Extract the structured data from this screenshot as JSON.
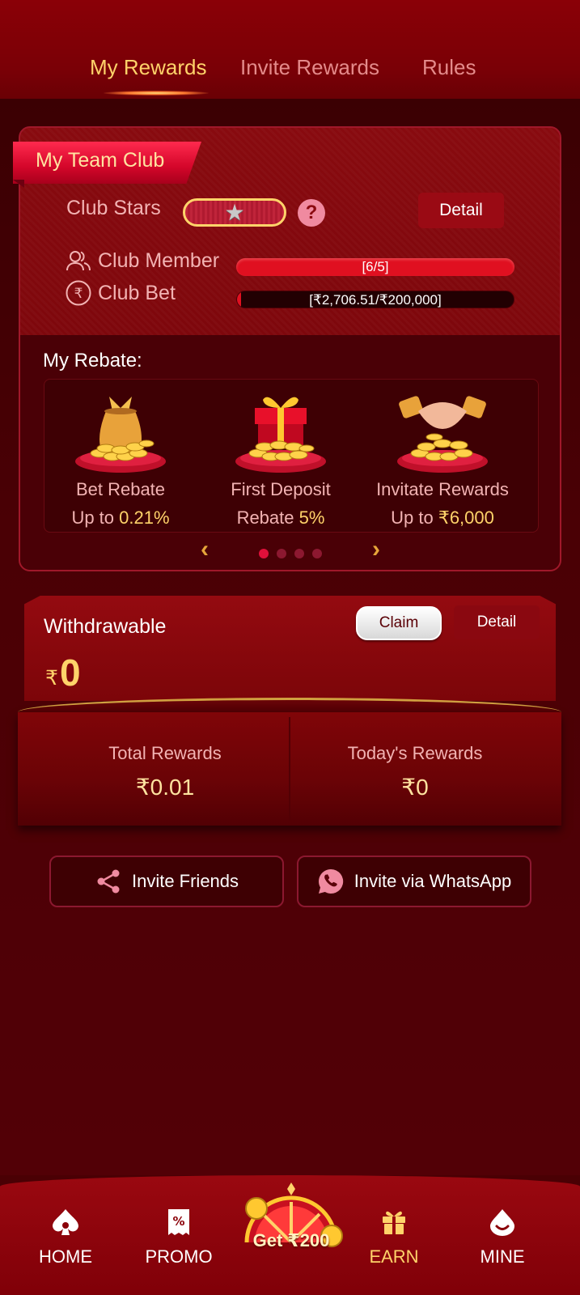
{
  "tabs": [
    {
      "label": "My Rewards",
      "active": true
    },
    {
      "label": "Invite Rewards",
      "active": false
    },
    {
      "label": "Rules",
      "active": false
    }
  ],
  "club": {
    "title": "My Team Club",
    "stars_label": "Club Stars",
    "stars_filled": 1,
    "detail_label": "Detail",
    "member_label": "Club Member",
    "member_progress": "[6/5]",
    "member_fraction": 1.0,
    "bet_label": "Club Bet",
    "bet_progress": "[₹2,706.51/₹200,000]",
    "bet_fraction": 0.0135
  },
  "rebate": {
    "title": "My Rebate:",
    "items": [
      {
        "name": "Bet Rebate",
        "prefix": "Up to",
        "value": "0.21%",
        "icon": "money-bag-icon"
      },
      {
        "name": "First Deposit",
        "prefix": "Rebate",
        "value": "5%",
        "icon": "gift-box-icon"
      },
      {
        "name": "Invitate Rewards",
        "prefix": "Up to",
        "value": "₹6,000",
        "icon": "handshake-icon"
      }
    ],
    "page_count": 4,
    "page_active": 1
  },
  "withdraw": {
    "title": "Withdrawable",
    "currency": "₹",
    "amount": "0",
    "claim_label": "Claim",
    "detail_label": "Detail"
  },
  "totals": {
    "total_label": "Total Rewards",
    "total_value": "₹0.01",
    "today_label": "Today's Rewards",
    "today_value": "₹0"
  },
  "invite": {
    "friends_label": "Invite Friends",
    "whatsapp_label": "Invite via WhatsApp"
  },
  "nav": {
    "home": "HOME",
    "promo": "PROMO",
    "wheel": "Get ₹200",
    "earn": "EARN",
    "mine": "MINE",
    "active": "EARN"
  },
  "colors": {
    "accent_gold": "#ffd36a",
    "primary_red": "#e01020",
    "background": "#4a0004"
  }
}
